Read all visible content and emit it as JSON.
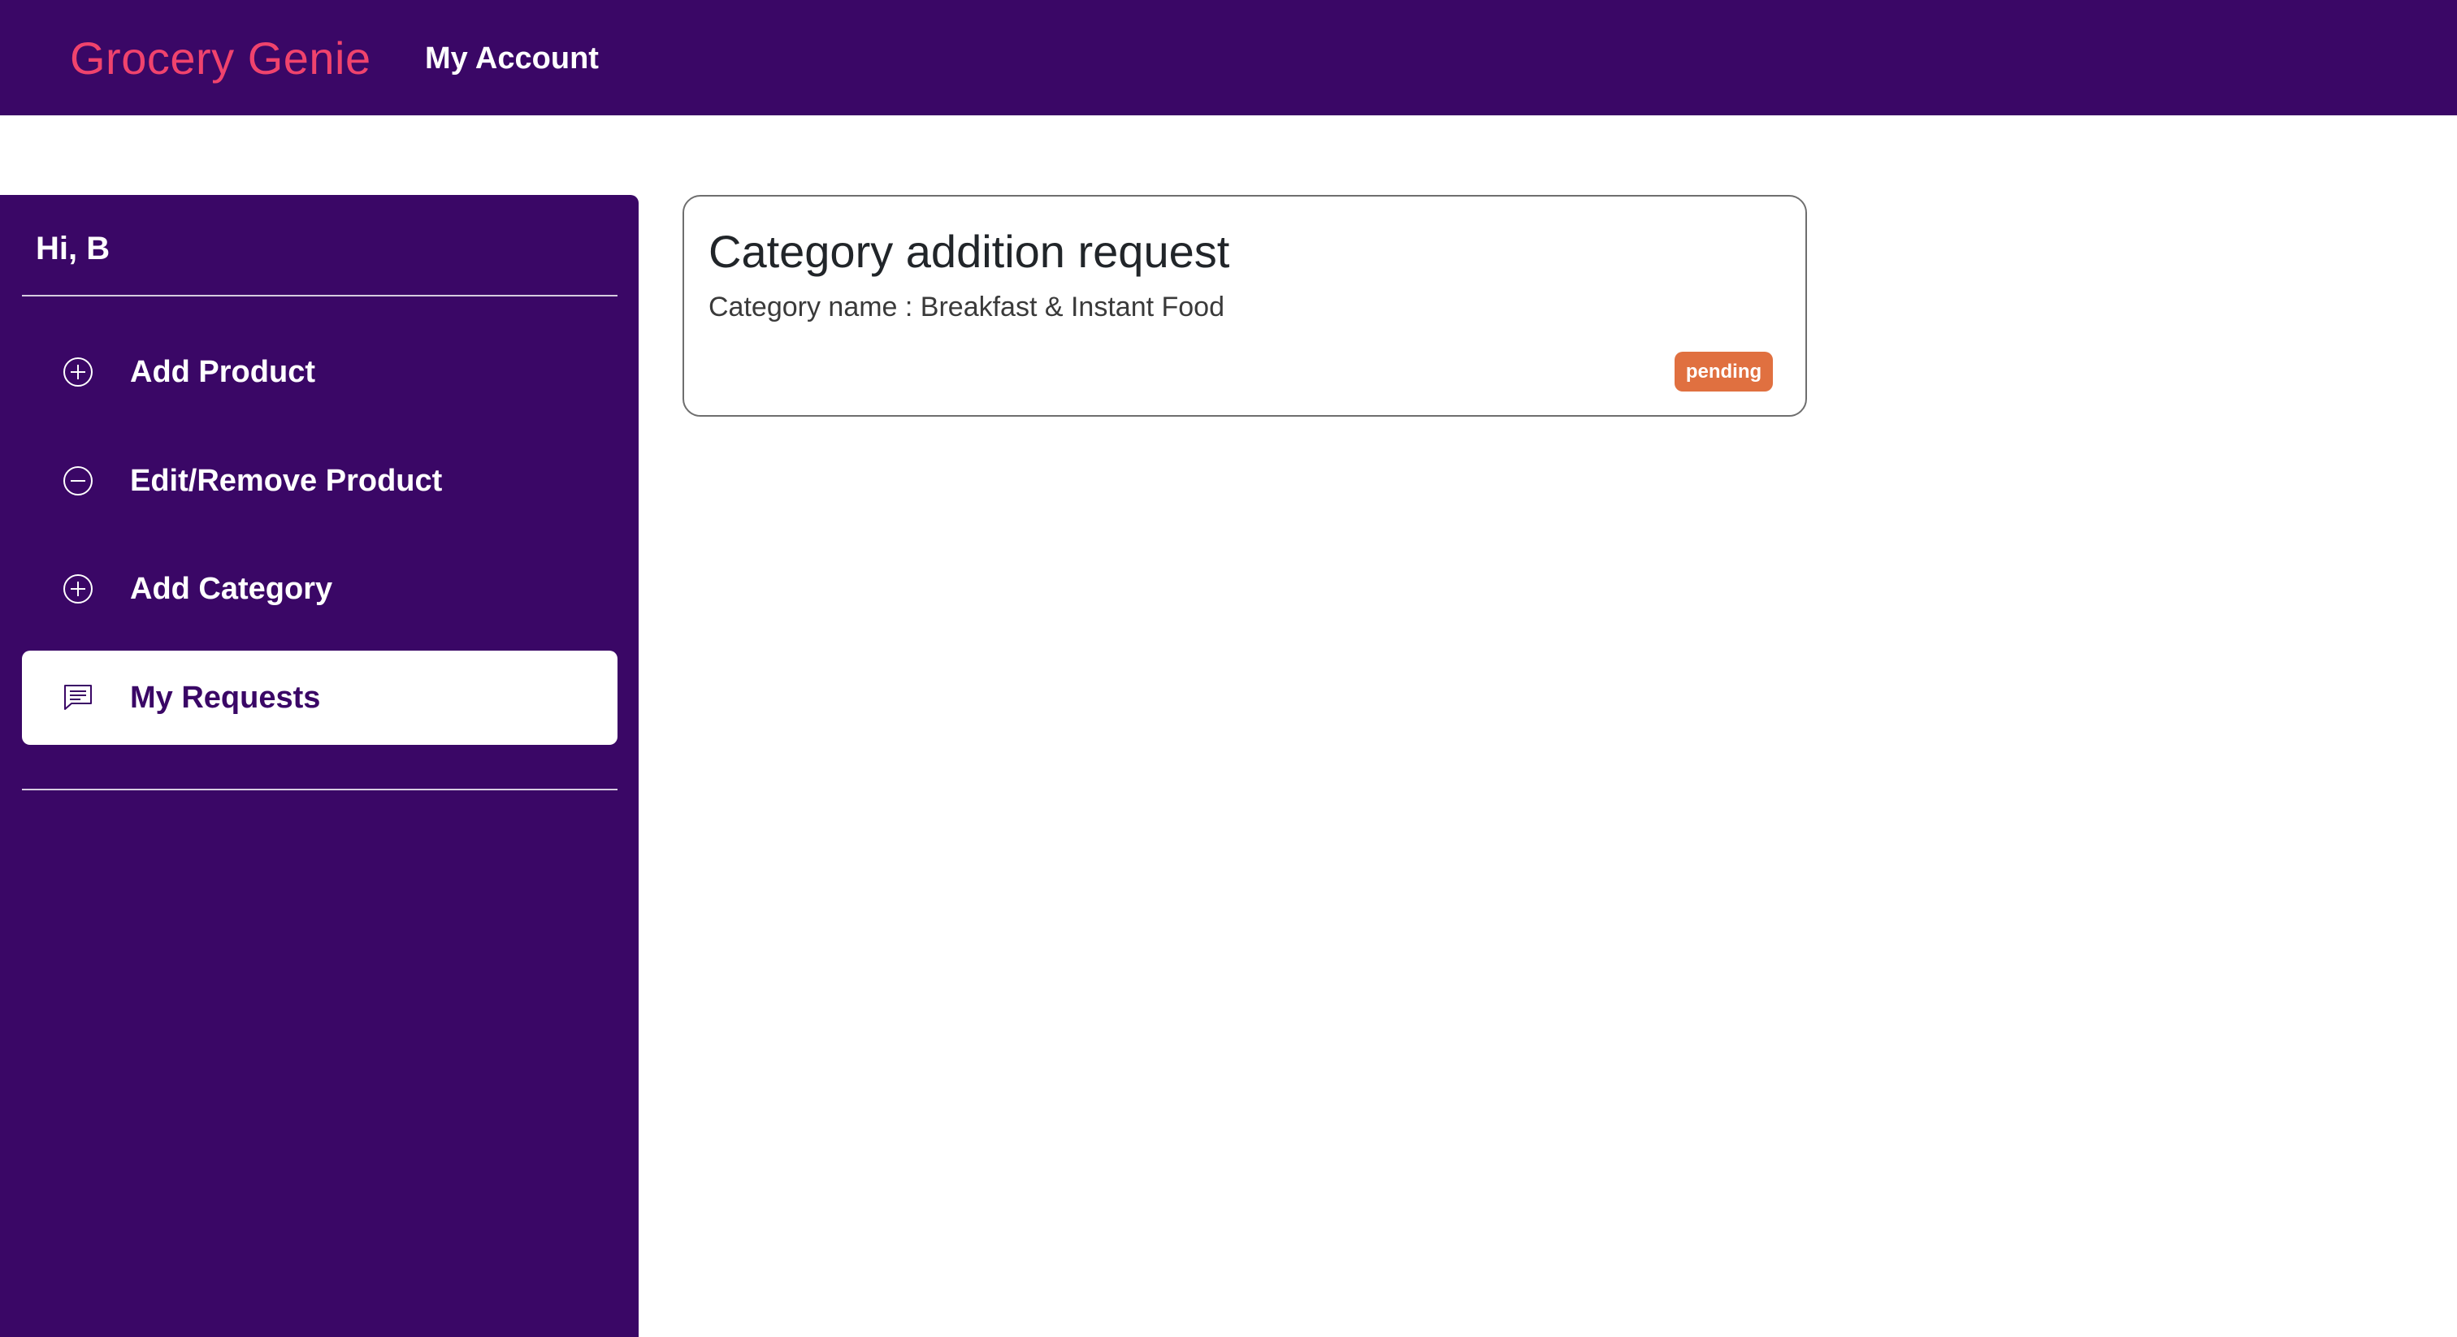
{
  "navbar": {
    "brand": "Grocery Genie",
    "account_link": "My Account"
  },
  "sidebar": {
    "greeting": "Hi, B",
    "items": [
      {
        "label": "Add Product",
        "icon": "plus-circle-icon",
        "active": false
      },
      {
        "label": "Edit/Remove Product",
        "icon": "minus-circle-icon",
        "active": false
      },
      {
        "label": "Add Category",
        "icon": "plus-circle-icon",
        "active": false
      },
      {
        "label": "My Requests",
        "icon": "message-icon",
        "active": true
      }
    ]
  },
  "requests": [
    {
      "title": "Category addition request",
      "detail": "Category name : Breakfast & Instant Food",
      "status": "pending"
    }
  ],
  "colors": {
    "brand_purple": "#3a0766",
    "brand_pink": "#f0436d",
    "status_pending": "#e07040",
    "active_item_bg": "#ffffff"
  }
}
